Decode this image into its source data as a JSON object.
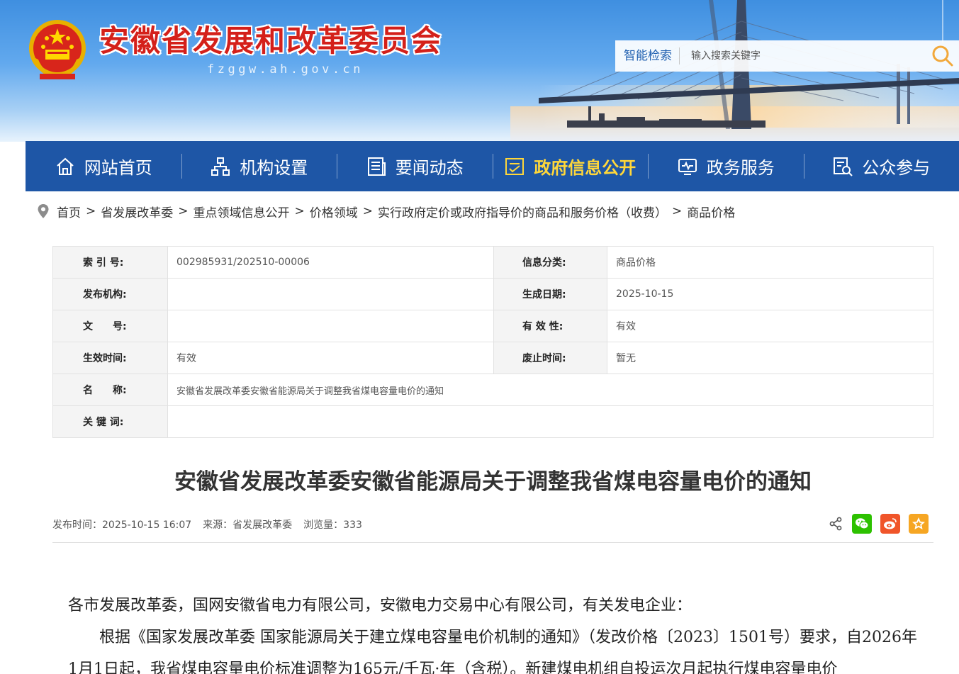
{
  "header": {
    "site_title": "安徽省发展和改革委员会",
    "site_domain": "fzggw.ah.gov.cn",
    "search_label": "智能检索",
    "search_placeholder": "输入搜索关键字"
  },
  "nav": {
    "items": [
      {
        "label": "网站首页",
        "icon": "home-icon"
      },
      {
        "label": "机构设置",
        "icon": "org-chart-icon"
      },
      {
        "label": "要闻动态",
        "icon": "news-icon"
      },
      {
        "label": "政府信息公开",
        "icon": "info-public-icon",
        "active": true
      },
      {
        "label": "政务服务",
        "icon": "service-monitor-icon"
      },
      {
        "label": "公众参与",
        "icon": "participation-icon"
      }
    ]
  },
  "breadcrumb": [
    "首页",
    "省发展改革委",
    "重点领域信息公开",
    "价格领域",
    "实行政府定价或政府指导价的商品和服务价格（收费）",
    "商品价格"
  ],
  "info": {
    "index_label": "索 引 号:",
    "index_value": "002985931/202510-00006",
    "category_label": "信息分类:",
    "category_value": "商品价格",
    "publisher_label": "发布机构:",
    "publisher_value": "",
    "generated_label": "生成日期:",
    "generated_value": "2025-10-15",
    "docno_label": "文　　号:",
    "docno_value": "",
    "validity_label": "有 效 性:",
    "validity_value": "有效",
    "effective_label": "生效时间:",
    "effective_value": "有效",
    "abolish_label": "废止时间:",
    "abolish_value": "暂无",
    "name_label": "名　　称:",
    "name_value": "安徽省发展改革委安徽省能源局关于调整我省煤电容量电价的通知",
    "keywords_label": "关 键 词:",
    "keywords_value": ""
  },
  "article": {
    "title": "安徽省发展改革委安徽省能源局关于调整我省煤电容量电价的通知",
    "publish_time": "发布时间：2025-10-15 16:07",
    "source": "来源：省发展改革委",
    "views": "浏览量：333",
    "para1": "各市发展改革委，国网安徽省电力有限公司，安徽电力交易中心有限公司，有关发电企业：",
    "para2": "根据《国家发展改革委 国家能源局关于建立煤电容量电价机制的通知》（发改价格〔2023〕1501号）要求，自2026年1月1日起，我省煤电容量电价标准调整为165元/千瓦·年（含税）。新建煤电机组自投运次月起执行煤电容量电价"
  },
  "colors": {
    "nav_bg": "#1e56a6",
    "nav_active": "#ffd73a",
    "title_red": "#d4201a",
    "wechat_green": "#2dc100",
    "weibo_orange": "#f0552a",
    "favorite_orange": "#f6a623"
  }
}
